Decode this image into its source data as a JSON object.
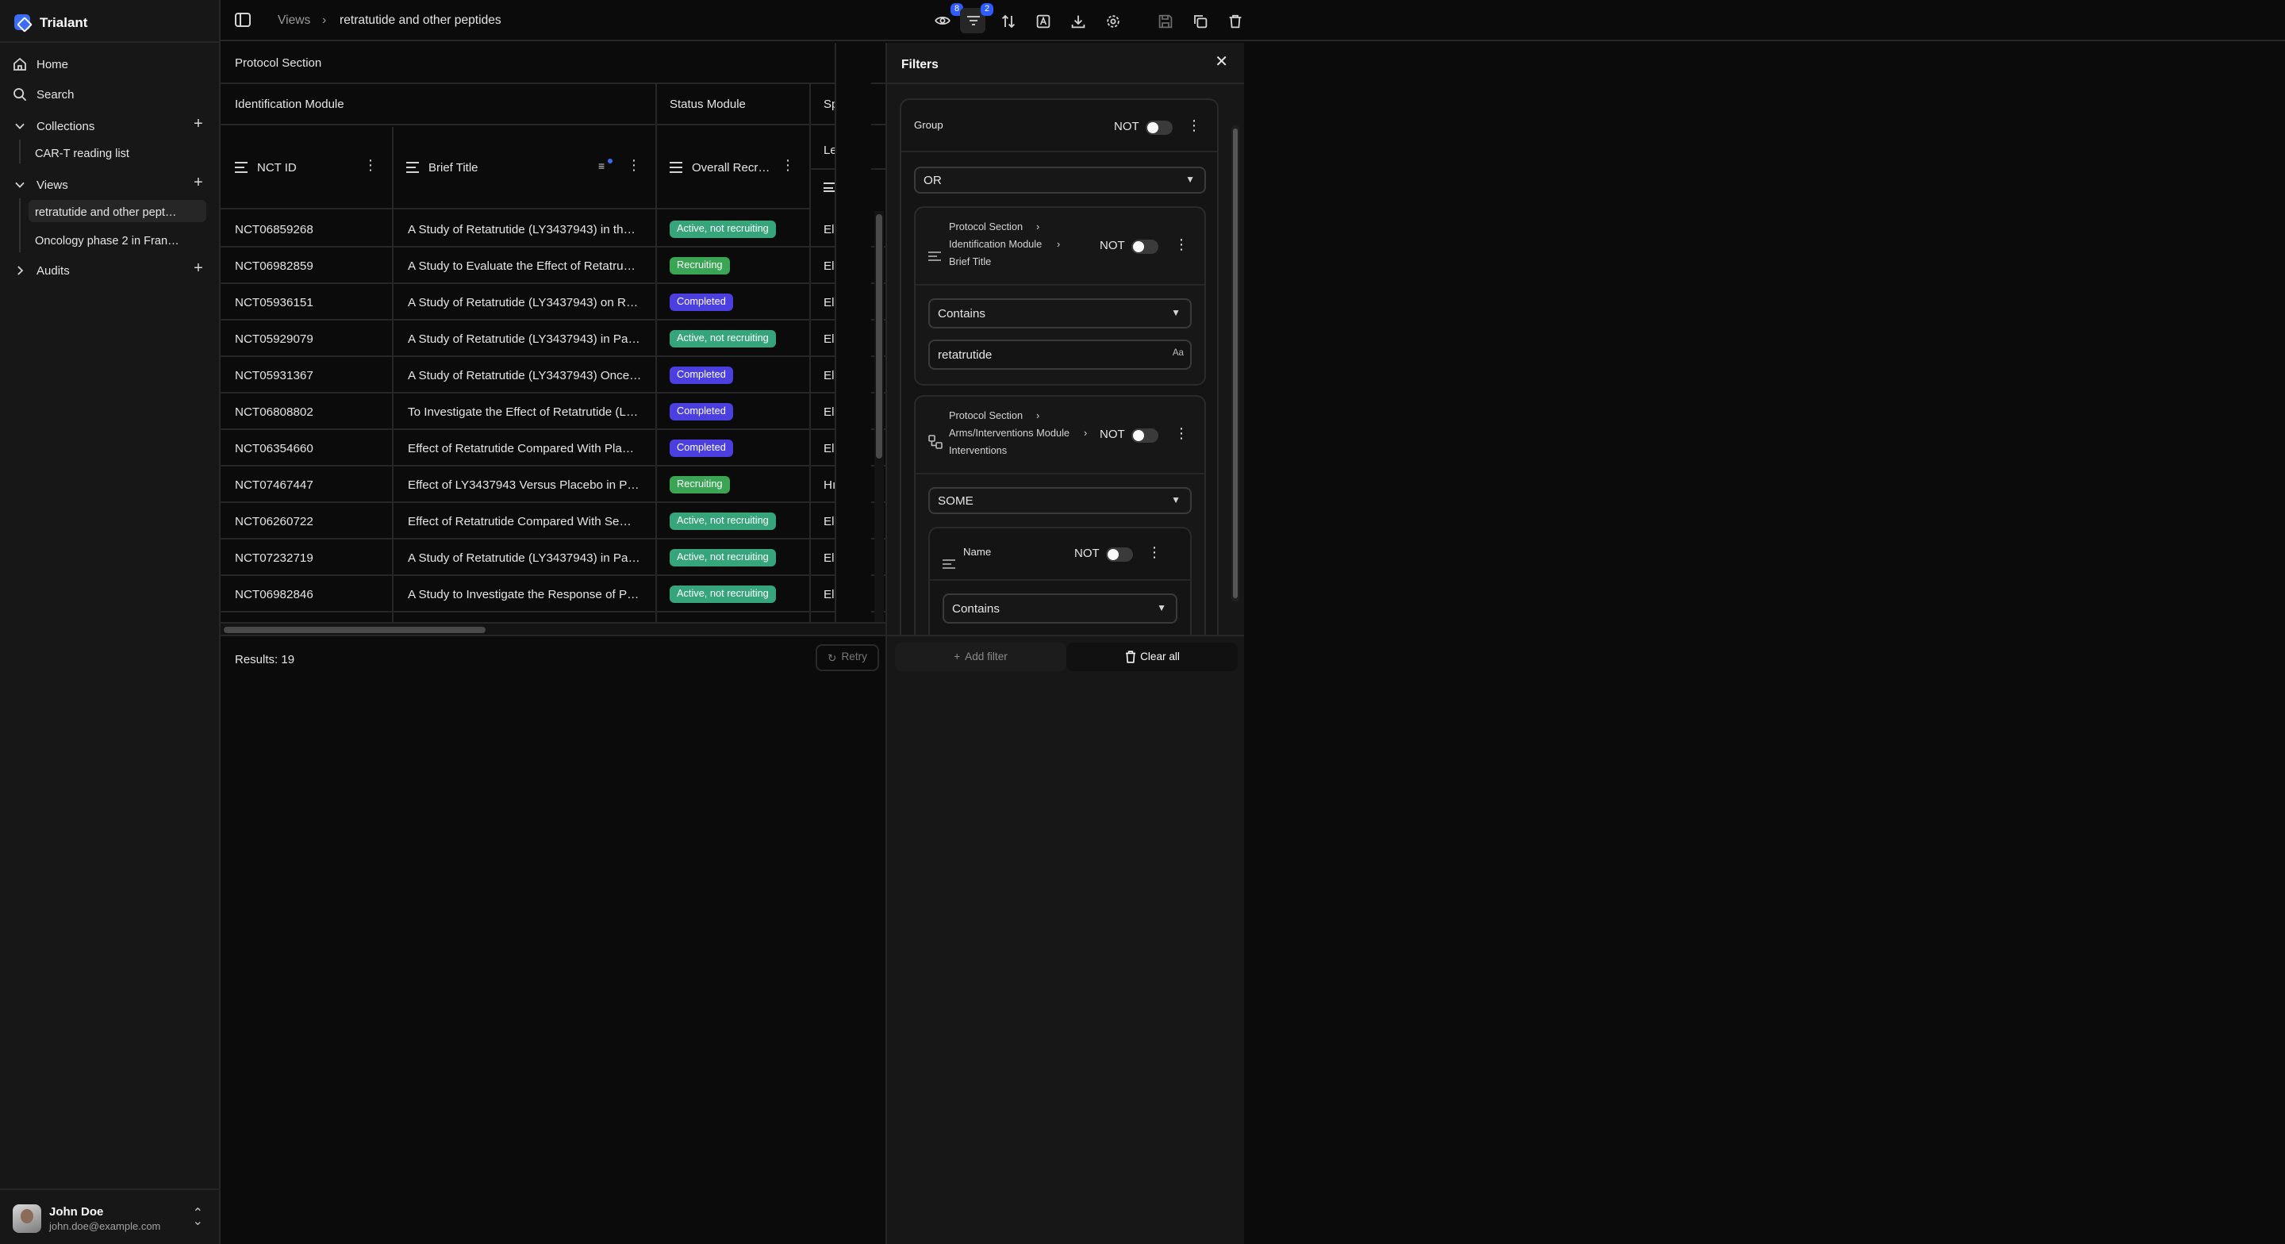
{
  "app": {
    "name": "Trialant"
  },
  "sidebar": {
    "home": "Home",
    "search": "Search",
    "collections": {
      "label": "Collections",
      "items": [
        "CAR-T reading list"
      ]
    },
    "views": {
      "label": "Views",
      "items": [
        "retratutide and other pept…",
        "Oncology phase 2 in Fran…"
      ]
    },
    "audits": {
      "label": "Audits"
    }
  },
  "user": {
    "name": "John Doe",
    "email": "john.doe@example.com"
  },
  "topbar": {
    "crumb_root": "Views",
    "crumb_current": "retratutide and other peptides",
    "visible_count": "8",
    "filter_count": "2"
  },
  "table": {
    "section_header": "Protocol Section",
    "group_identification": "Identification Module",
    "group_status": "Status Module",
    "group_next": "Sp",
    "col_nct": "NCT ID",
    "col_title": "Brief Title",
    "col_status": "Overall Recr…",
    "col_next": "Le",
    "rows": [
      {
        "nct": "NCT06859268",
        "title": "A Study of Retatrutide (LY3437943) in th…",
        "status": "Active, not recruiting",
        "kind": "active",
        "next": "El"
      },
      {
        "nct": "NCT06982859",
        "title": "A Study to Evaluate the Effect of Retatru…",
        "status": "Recruiting",
        "kind": "recruit",
        "next": "El"
      },
      {
        "nct": "NCT05936151",
        "title": "A Study of Retatrutide (LY3437943) on R…",
        "status": "Completed",
        "kind": "done",
        "next": "El"
      },
      {
        "nct": "NCT05929079",
        "title": "A Study of Retatrutide (LY3437943) in Pa…",
        "status": "Active, not recruiting",
        "kind": "active",
        "next": "El"
      },
      {
        "nct": "NCT05931367",
        "title": "A Study of Retatrutide (LY3437943) Once…",
        "status": "Completed",
        "kind": "done",
        "next": "El"
      },
      {
        "nct": "NCT06808802",
        "title": "To Investigate the Effect of Retatrutide (L…",
        "status": "Completed",
        "kind": "done",
        "next": "El"
      },
      {
        "nct": "NCT06354660",
        "title": "Effect of Retatrutide Compared With Pla…",
        "status": "Completed",
        "kind": "done",
        "next": "El"
      },
      {
        "nct": "NCT07467447",
        "title": "Effect of LY3437943 Versus Placebo in P…",
        "status": "Recruiting",
        "kind": "recruit",
        "next": "Hı"
      },
      {
        "nct": "NCT06260722",
        "title": "Effect of Retatrutide Compared With Se…",
        "status": "Active, not recruiting",
        "kind": "active",
        "next": "El"
      },
      {
        "nct": "NCT07232719",
        "title": "A Study of Retatrutide (LY3437943) in Pa…",
        "status": "Active, not recruiting",
        "kind": "active",
        "next": "El"
      },
      {
        "nct": "NCT06982846",
        "title": "A Study to Investigate the Response of P…",
        "status": "Active, not recruiting",
        "kind": "active",
        "next": "El"
      }
    ],
    "results": "Results: 19",
    "retry": "Retry"
  },
  "filters": {
    "title": "Filters",
    "group_label": "Group",
    "not_label": "NOT",
    "group_op": "OR",
    "f1": {
      "path1": "Protocol Section",
      "path2": "Identification Module",
      "path3": "Brief Title",
      "op": "Contains",
      "value": "retatrutide",
      "case_icon": "Aa"
    },
    "f2": {
      "path1": "Protocol Section",
      "path2": "Arms/Interventions Module",
      "path3": "Interventions",
      "op": "SOME",
      "sub_field": "Name",
      "sub_op": "Contains"
    },
    "add_filter": "Add filter",
    "clear_all": "Clear all"
  },
  "colors": {
    "accent": "#2f5bff",
    "active_not_recruiting": "#36a57c",
    "recruiting": "#3aa655",
    "completed": "#4b3fe0"
  }
}
